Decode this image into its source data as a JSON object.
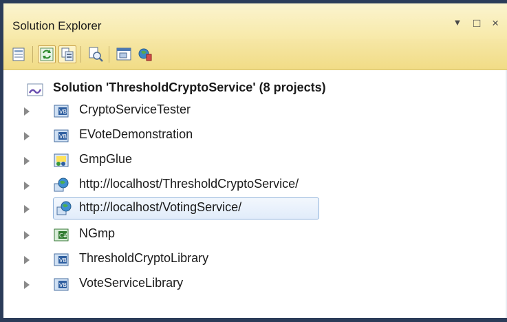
{
  "window": {
    "title": "Solution Explorer",
    "controls": "▾ □ ×"
  },
  "toolbar": {
    "buttons": [
      {
        "icon": "properties-icon",
        "active": false
      },
      {
        "icon": "refresh-icon",
        "active": true
      },
      {
        "icon": "show-all-files-icon",
        "active": true
      },
      {
        "icon": "view-code-icon",
        "active": false
      },
      {
        "icon": "view-designer-icon",
        "active": false
      },
      {
        "icon": "class-diagram-icon",
        "active": false
      }
    ]
  },
  "tree": {
    "solution": "Solution 'ThresholdCryptoService' (8 projects)",
    "items": [
      {
        "label": "CryptoServiceTester",
        "icon": "vb-project-icon"
      },
      {
        "label": "EVoteDemonstration",
        "icon": "vb-project-icon"
      },
      {
        "label": "GmpGlue",
        "icon": "cpp-project-icon"
      },
      {
        "label": "http://localhost/ThresholdCryptoService/",
        "icon": "website-project-icon"
      },
      {
        "label": "http://localhost/VotingService/",
        "icon": "website-project-icon",
        "selected": true
      },
      {
        "label": "NGmp",
        "icon": "csharp-project-icon"
      },
      {
        "label": "ThresholdCryptoLibrary",
        "icon": "vb-project-icon"
      },
      {
        "label": "VoteServiceLibrary",
        "icon": "vb-project-icon"
      }
    ]
  },
  "colors": {
    "title_bar": "#f7e9a8",
    "toolbar": "#f1dc86",
    "selection_border": "#8fb2da",
    "frame": "#2b3c59"
  }
}
